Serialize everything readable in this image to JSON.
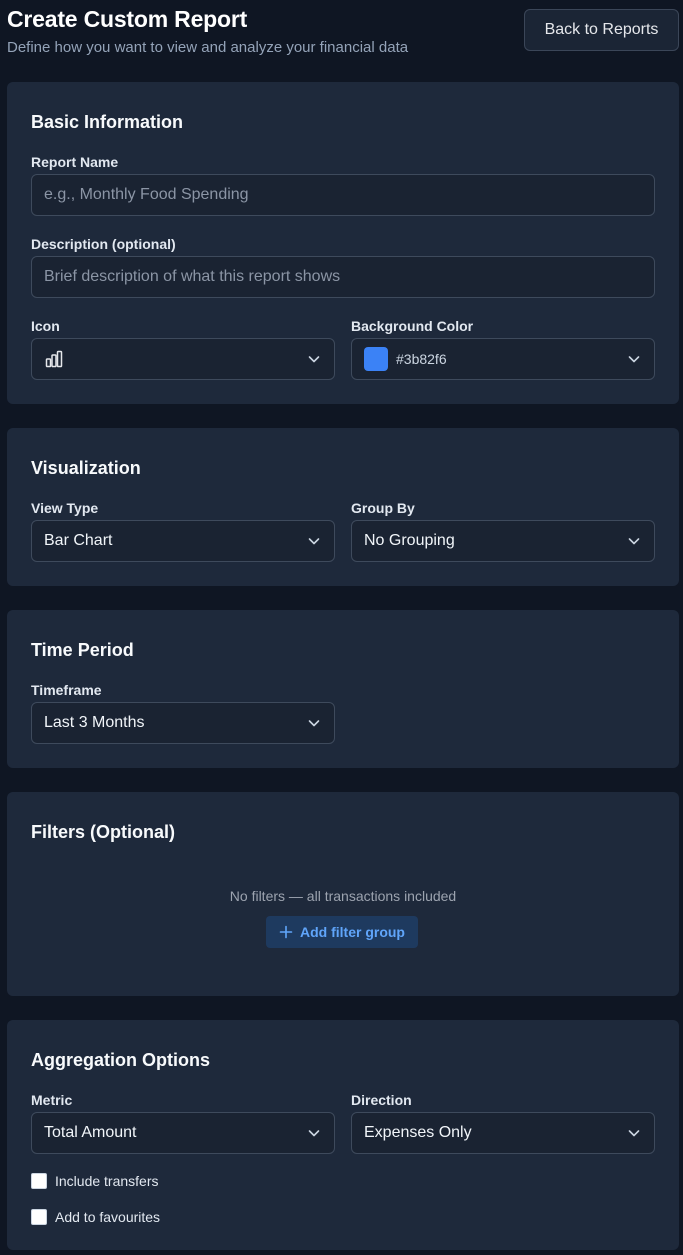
{
  "header": {
    "title": "Create Custom Report",
    "subtitle": "Define how you want to view and analyze your financial data",
    "back_label": "Back to Reports"
  },
  "basic": {
    "title": "Basic Information",
    "report_name_label": "Report Name",
    "report_name_placeholder": "e.g., Monthly Food Spending",
    "description_label": "Description (optional)",
    "description_placeholder": "Brief description of what this report shows",
    "icon_label": "Icon",
    "icon_value": "bar-chart-icon",
    "bg_color_label": "Background Color",
    "bg_color_value": "#3b82f6"
  },
  "visualization": {
    "title": "Visualization",
    "view_type_label": "View Type",
    "view_type_value": "Bar Chart",
    "group_by_label": "Group By",
    "group_by_value": "No Grouping"
  },
  "time_period": {
    "title": "Time Period",
    "timeframe_label": "Timeframe",
    "timeframe_value": "Last 3 Months"
  },
  "filters": {
    "title": "Filters (Optional)",
    "empty_text": "No filters — all transactions included",
    "add_label": "Add filter group"
  },
  "aggregation": {
    "title": "Aggregation Options",
    "metric_label": "Metric",
    "metric_value": "Total Amount",
    "direction_label": "Direction",
    "direction_value": "Expenses Only",
    "include_transfers_label": "Include transfers",
    "add_favourites_label": "Add to favourites"
  },
  "colors": {
    "accent": "#60a5fa",
    "swatch": "#3b82f6",
    "card": "#1e293b",
    "page": "#0f1623"
  }
}
